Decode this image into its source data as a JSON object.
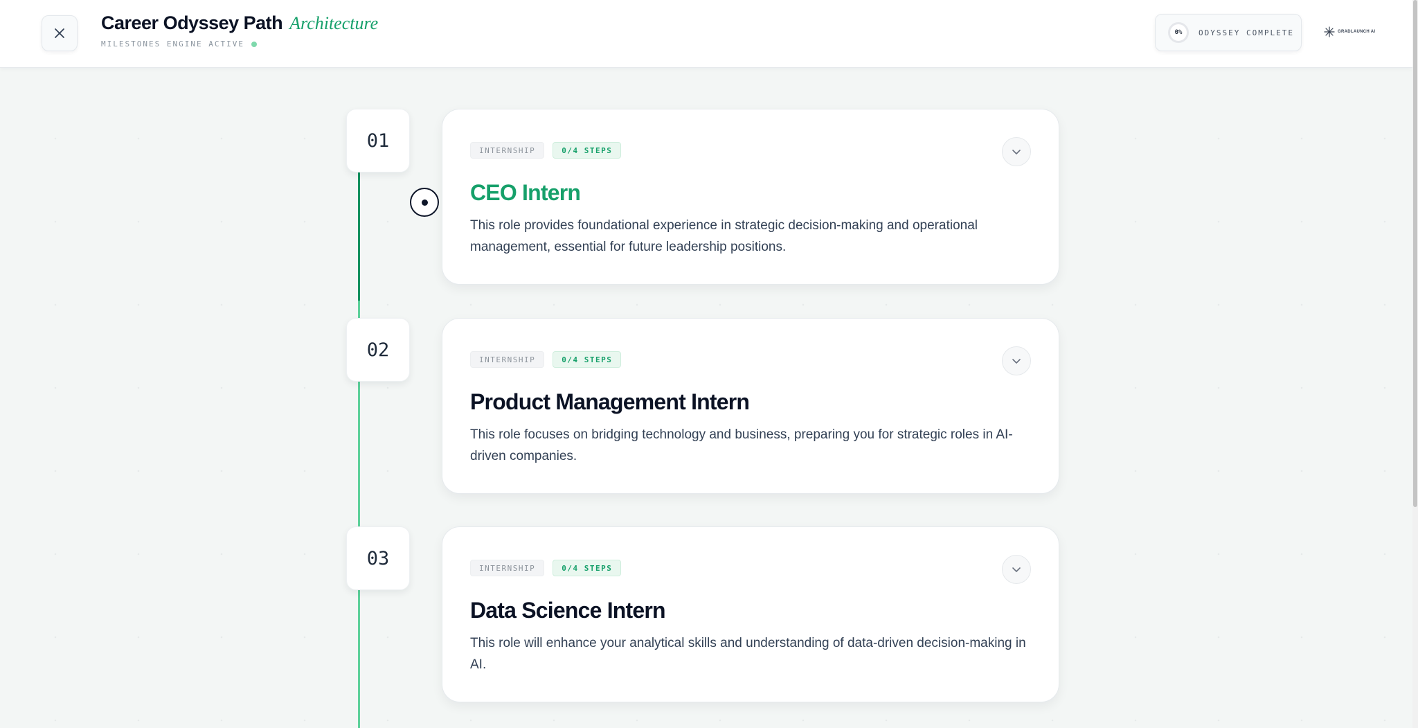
{
  "header": {
    "title": "Career Odyssey Path",
    "title_accent": "Architecture",
    "status": "MILESTONES ENGINE ACTIVE",
    "progress_value": "0%",
    "progress_label": "ODYSSEY COMPLETE",
    "brand": "GRADLAUNCH AI"
  },
  "icons": {
    "close": "close-icon",
    "expand": "chevron-down-icon",
    "brand": "spark-logo-icon"
  },
  "colors": {
    "accent": "#16a06a",
    "timeline": "#5ed19b",
    "title_dark": "#0b1224"
  },
  "milestones": [
    {
      "number": "01",
      "type": "INTERNSHIP",
      "steps": "0/4 STEPS",
      "title": "CEO Intern",
      "description": "This role provides foundational experience in strategic decision-making and operational management, essential for future leadership positions.",
      "active": true
    },
    {
      "number": "02",
      "type": "INTERNSHIP",
      "steps": "0/4 STEPS",
      "title": "Product Management Intern",
      "description": "This role focuses on bridging technology and business, preparing you for strategic roles in AI-driven companies.",
      "active": false
    },
    {
      "number": "03",
      "type": "INTERNSHIP",
      "steps": "0/4 STEPS",
      "title": "Data Science Intern",
      "description": "This role will enhance your analytical skills and understanding of data-driven decision-making in AI.",
      "active": false
    }
  ]
}
